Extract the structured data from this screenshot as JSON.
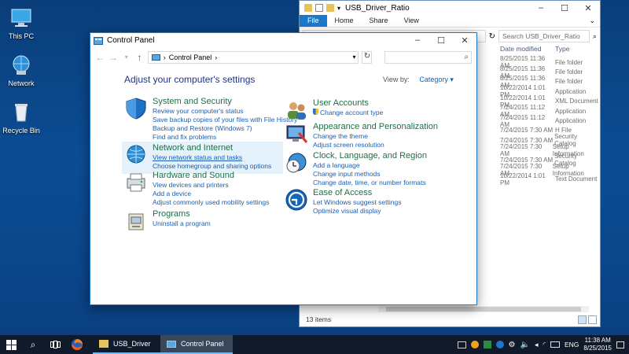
{
  "desktop": {
    "icons": [
      {
        "label": "This PC"
      },
      {
        "label": "Network"
      },
      {
        "label": "Recycle Bin"
      }
    ]
  },
  "explorer": {
    "title": "USB_Driver_Ratio",
    "ribbon_tabs": [
      "File",
      "Home",
      "Share",
      "View"
    ],
    "search_placeholder": "Search USB_Driver_Ratio",
    "columns": {
      "date": "Date modified",
      "type": "Type"
    },
    "rows": [
      {
        "date": "8/25/2015 11:36 AM",
        "type": "File folder"
      },
      {
        "date": "8/25/2015 11:36 AM",
        "type": "File folder"
      },
      {
        "date": "8/25/2015 11:36 AM",
        "type": "File folder"
      },
      {
        "date": "10/22/2014 1:01 PM",
        "type": "Application"
      },
      {
        "date": "10/22/2014 1:01 PM",
        "type": "XML Document"
      },
      {
        "date": "7/24/2015 11:12 AM",
        "type": "Application"
      },
      {
        "date": "7/24/2015 11:12 AM",
        "type": "Application"
      },
      {
        "date": "7/24/2015 7:30 AM",
        "type": "H File"
      },
      {
        "date": "7/24/2015 7:30 AM",
        "type": "Security Catalog"
      },
      {
        "date": "7/24/2015 7:30 AM",
        "type": "Setup Information"
      },
      {
        "date": "7/24/2015 7:30 AM",
        "type": "Security Catalog"
      },
      {
        "date": "7/24/2015 7:30 AM",
        "type": "Setup Information"
      },
      {
        "date": "10/22/2014 1:01 PM",
        "type": "Text Document"
      }
    ],
    "status": "13 items"
  },
  "control_panel": {
    "title": "Control Panel",
    "address": "Control Panel",
    "heading": "Adjust your computer's settings",
    "view_by_label": "View by:",
    "view_by_value": "Category",
    "categories": [
      {
        "title": "System and Security",
        "links": [
          "Review your computer's status",
          "Save backup copies of your files with File History",
          "Backup and Restore (Windows 7)",
          "Find and fix problems"
        ]
      },
      {
        "title": "Network and Internet",
        "links": [
          "View network status and tasks",
          "Choose homegroup and sharing options"
        ]
      },
      {
        "title": "Hardware and Sound",
        "links": [
          "View devices and printers",
          "Add a device",
          "Adjust commonly used mobility settings"
        ]
      },
      {
        "title": "Programs",
        "links": [
          "Uninstall a program"
        ]
      },
      {
        "title": "User Accounts",
        "links": [
          "Change account type"
        ]
      },
      {
        "title": "Appearance and Personalization",
        "links": [
          "Change the theme",
          "Adjust screen resolution"
        ]
      },
      {
        "title": "Clock, Language, and Region",
        "links": [
          "Add a language",
          "Change input methods",
          "Change date, time, or number formats"
        ]
      },
      {
        "title": "Ease of Access",
        "links": [
          "Let Windows suggest settings",
          "Optimize visual display"
        ]
      }
    ]
  },
  "taskbar": {
    "apps": [
      {
        "label": "USB_Driver"
      },
      {
        "label": "Control Panel"
      }
    ],
    "language": "ENG",
    "time": "11:38 AM",
    "date": "8/25/2015"
  },
  "colors": {
    "accent": "#1979ca",
    "category_title": "#1e7145",
    "link": "#1a5fb4",
    "heading": "#1e3287"
  }
}
